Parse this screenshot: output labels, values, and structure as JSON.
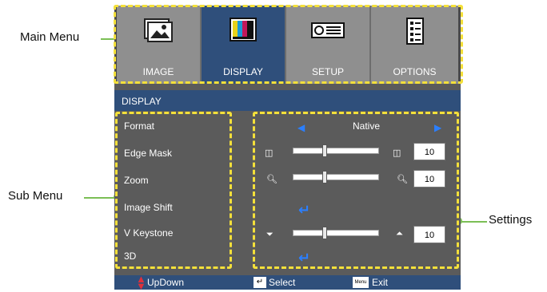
{
  "callouts": {
    "main_menu": "Main Menu",
    "sub_menu": "Sub Menu",
    "settings": "Settings"
  },
  "tabs": [
    {
      "label": "IMAGE",
      "icon": "image-icon"
    },
    {
      "label": "DISPLAY",
      "icon": "display-icon"
    },
    {
      "label": "SETUP",
      "icon": "projector-icon"
    },
    {
      "label": "OPTIONS",
      "icon": "options-icon"
    }
  ],
  "active_tab": "DISPLAY",
  "section_title": "DISPLAY",
  "submenu": [
    "Format",
    "Edge Mask",
    "Zoom",
    "Image Shift",
    "V Keystone",
    "3D"
  ],
  "settings": {
    "format_value": "Native",
    "edge_mask_value": "10",
    "zoom_value": "10",
    "v_keystone_value": "10"
  },
  "footer": {
    "updown": "UpDown",
    "select": "Select",
    "exit": "Exit",
    "menu_key": "Menu"
  },
  "colors": {
    "accent": "#2f4f7b",
    "highlight": "#f4e03a",
    "callout_line": "#7bbf55",
    "arrow_blue": "#2b7fff"
  }
}
